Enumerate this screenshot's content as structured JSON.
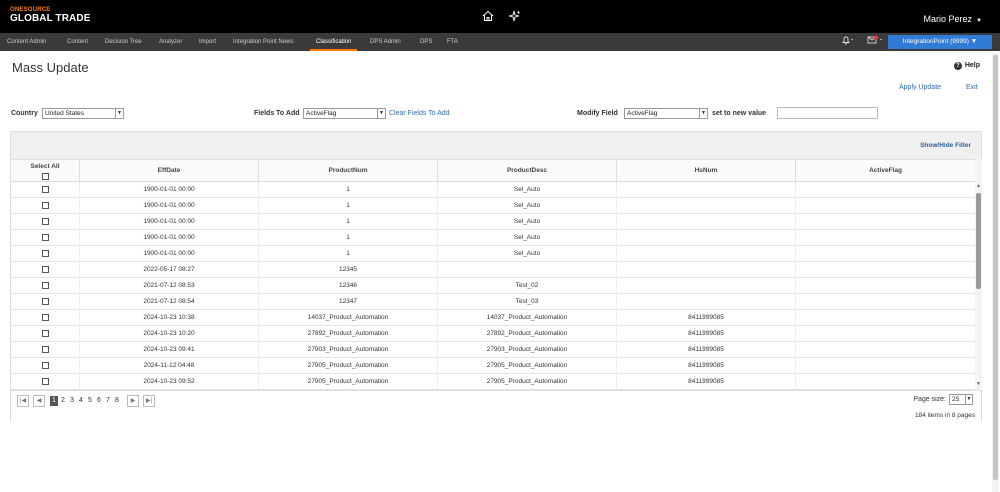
{
  "brand": {
    "line1": "ONESOURCE",
    "line2": "GLOBAL TRADE"
  },
  "header": {
    "icons": [
      "home-icon",
      "sparkle-icon"
    ],
    "user_name": "Mario Perez"
  },
  "nav": {
    "tabs": [
      {
        "label": "Content Admin"
      },
      {
        "label": "Content"
      },
      {
        "label": "Decision Tree"
      },
      {
        "label": "Analyzer"
      },
      {
        "label": "Import"
      },
      {
        "label": "Integration Point News"
      },
      {
        "label": "Classification"
      },
      {
        "label": "DPS Admin"
      },
      {
        "label": "DPS"
      },
      {
        "label": "FTA"
      }
    ],
    "active_tab": "Classification",
    "integration_button": "IntegrationPoint (9999)"
  },
  "page": {
    "title": "Mass Update",
    "help_label": "Help",
    "apply_update": "Apply Update",
    "exit": "Exit"
  },
  "form": {
    "country_label": "Country",
    "country_value": "United States",
    "fields_to_add_label": "Fields To Add",
    "fields_to_add_value": "ActiveFlag",
    "clear_fields": "Clear Fields To Add",
    "modify_field_label": "Modify Field",
    "modify_field_value": "ActiveFlag",
    "set_new_value_label": "set to new value",
    "new_value": ""
  },
  "grid": {
    "show_hide_filter": "Show/Hide Filter",
    "select_all_label": "Select All",
    "columns": [
      "EffDate",
      "ProductNum",
      "ProductDesc",
      "HsNum",
      "ActiveFlag"
    ],
    "rows": [
      [
        "1900-01-01 00:00",
        "1",
        "Sel_Auto",
        "",
        ""
      ],
      [
        "1900-01-01 00:00",
        "1",
        "Sel_Auto",
        "",
        ""
      ],
      [
        "1900-01-01 00:00",
        "1",
        "Sel_Auto",
        "",
        ""
      ],
      [
        "1900-01-01 00:00",
        "1",
        "Sel_Auto",
        "",
        ""
      ],
      [
        "1900-01-01 00:00",
        "1",
        "Sel_Auto",
        "",
        ""
      ],
      [
        "2022-05-17 08:27",
        "12345",
        "",
        "",
        ""
      ],
      [
        "2021-07-12 08:53",
        "12346",
        "Test_02",
        "",
        ""
      ],
      [
        "2021-07-12 08:54",
        "12347",
        "Test_03",
        "",
        ""
      ],
      [
        "2024-10-23 10:38",
        "14037_Product_Automation",
        "14037_Product_Automation",
        "8411999085",
        ""
      ],
      [
        "2024-10-23 10:20",
        "27892_Product_Automation",
        "27892_Product_Automation",
        "8411999085",
        ""
      ],
      [
        "2024-10-23 09:41",
        "27903_Product_Automation",
        "27903_Product_Automation",
        "8411999085",
        ""
      ],
      [
        "2024-11-12 04:48",
        "27905_Product_Automation",
        "27905_Product_Automation",
        "8411999085",
        ""
      ],
      [
        "2024-10-23 09:52",
        "27905_Product_Automation",
        "27905_Product_Automation",
        "8411999085",
        ""
      ]
    ]
  },
  "pager": {
    "pages": [
      "1",
      "2",
      "3",
      "4",
      "5",
      "6",
      "7",
      "8"
    ],
    "current_page": "1",
    "page_size_label": "Page size:",
    "page_size": "25",
    "items_info": "184 items in 8 pages"
  }
}
